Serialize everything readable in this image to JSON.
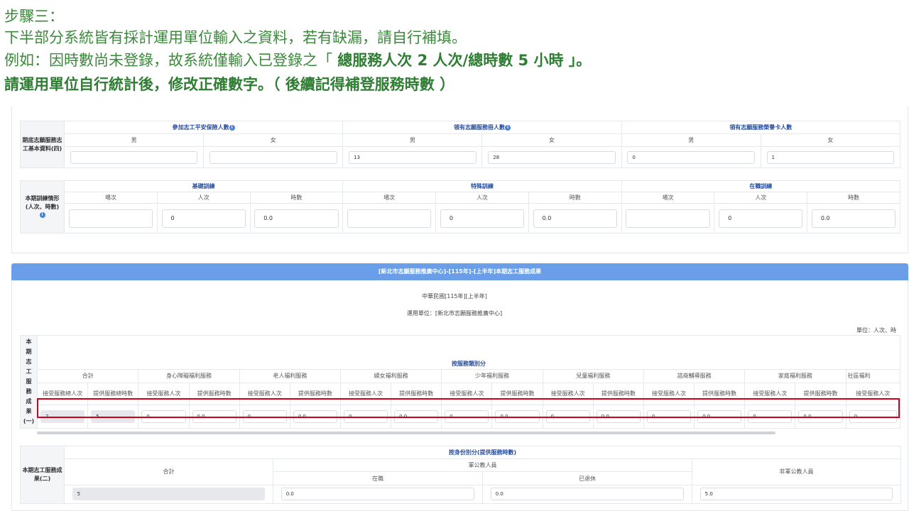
{
  "instructions": {
    "line1": "步驟三：",
    "line2": "下半部分系統皆有採計運用單位輸入之資料，若有缺漏，請自行補填。",
    "line3_prefix": "例如：因時數尚未登錄，故系統僅輸入已登錄之「",
    "line3_bold": " 總服務人次 2 人次/總時數 5 小時 」。",
    "line4": "請運用單位自行統計後，修改正確數字。（ 後續記得補登服務時數 ）"
  },
  "volunteer_basic": {
    "row_label": "期底志願服務志工基本資料(四)",
    "groups": [
      "參加志工平安保險人數",
      "領有志願服務冊人數",
      "領有志願服務榮譽卡人數"
    ],
    "genders": [
      "男",
      "女",
      "男",
      "女",
      "男",
      "女"
    ],
    "values": [
      "",
      "",
      "13",
      "28",
      "0",
      "1"
    ]
  },
  "training": {
    "row_label": "本期訓練情形(人次、時數)",
    "groups": [
      "基礎訓練",
      "特殊訓練",
      "在職訓練"
    ],
    "cols": [
      "場次",
      "人次",
      "時數",
      "場次",
      "人次",
      "時數",
      "場次",
      "人次",
      "時數"
    ],
    "values": [
      "",
      "0",
      "0.0",
      "",
      "0",
      "0.0",
      "",
      "0",
      "0.0"
    ]
  },
  "results_section": {
    "bar_title": "[新北市志願服務推廣中心]-[115年]-[上半年]本期志工服務成果",
    "date_line": "中華民國[115年][上半年]",
    "unit_line": "運用單位：[新北市志願服務推廣中心]",
    "unit_label": "單位：人次、時"
  },
  "results_one": {
    "row_label_chars": [
      "本",
      "期",
      "志",
      "工",
      "服",
      "務",
      "成",
      "果",
      "(一)"
    ],
    "top_header": "按服務類別分",
    "categories": [
      "合計",
      "身心障礙福利服務",
      "老人福利服務",
      "婦女福利服務",
      "少年福利服務",
      "兒童福利服務",
      "諮商輔導服務",
      "家庭福利服務",
      "社區福利"
    ],
    "total_cols": [
      "接受服務總人次",
      "提供服務總時數"
    ],
    "sub_cols": [
      "接受服務人次",
      "提供服務時數"
    ],
    "values": [
      "2",
      "5",
      "0",
      "0.0",
      "0",
      "0.0",
      "0",
      "0.0",
      "0",
      "0.0",
      "0",
      "0.0",
      "0",
      "0.0",
      "0",
      "0.0",
      "0"
    ]
  },
  "results_two": {
    "row_label": "本期志工服務成果(二)",
    "top_header": "按身份別分(提供服務時數)",
    "total": "合計",
    "civil": "軍公教人員",
    "active": "在職",
    "retired": "已退休",
    "non_civil": "非軍公教人員",
    "values": [
      "5",
      "0.0",
      "0.0",
      "5.0"
    ]
  },
  "colors": {
    "instruction_green": "#3a8a3a",
    "header_blue": "#6a9ee8",
    "highlight_red": "#d0021b"
  }
}
